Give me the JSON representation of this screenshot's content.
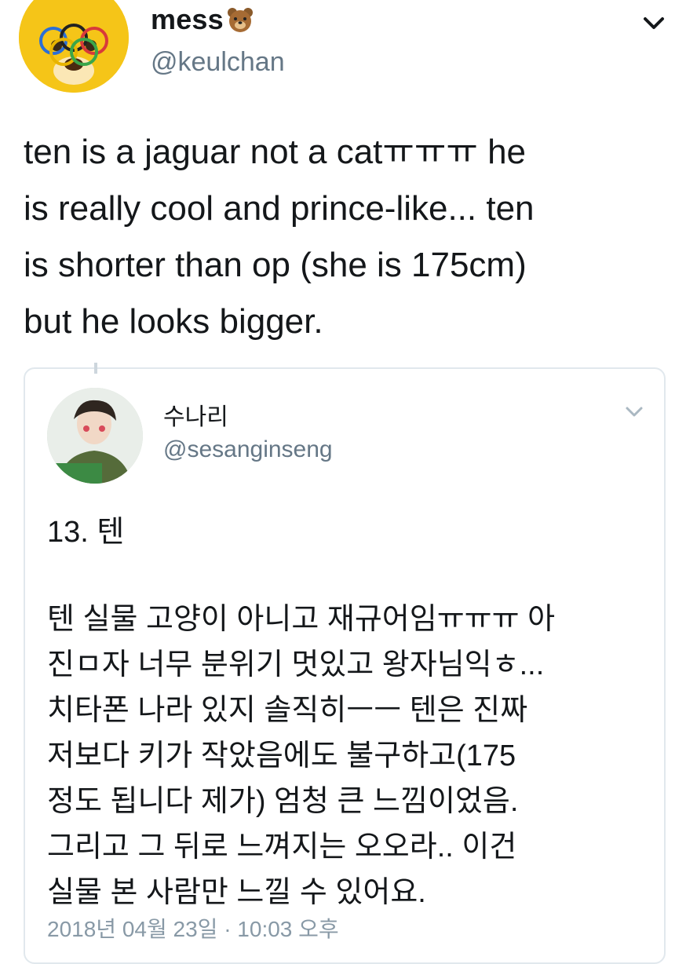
{
  "author": {
    "display_name": "mess",
    "name_emoji": "bear-face-emoji",
    "handle": "@keulchan"
  },
  "tweet": {
    "lines": [
      "ten is a jaguar not a catㅠㅠㅠ he",
      "is really cool and prince-like... ten",
      "is shorter than op (she is 175cm)",
      "but he looks bigger."
    ]
  },
  "quoted": {
    "display_name": "수나리",
    "handle": "@sesanginseng",
    "heading": "13. 텐",
    "lines": [
      "텐 실물 고양이 아니고 재규어임ㅠㅠㅠ 아",
      "진ㅁ자 너무 분위기 멋있고 왕자님익ㅎ...",
      "치타폰 나라 있지 솔직히ㅡㅡ 텐은 진짜",
      "저보다 키가 작았음에도 불구하고(175",
      "정도 됩니다 제가) 엄청 큰 느낌이었음.",
      "그리고 그 뒤로 느껴지는 오오라.. 이건",
      "실물 본 사람만 느낄 수 있어요."
    ],
    "timestamp": "2018년 04월 23일 · 10:03 오후"
  },
  "colors": {
    "text": "#14171a",
    "secondary": "#657786",
    "border": "#e1e8ed",
    "avatar_bg": "#f5c518"
  },
  "icons": {
    "main_avatar": "bear-avatar-icon",
    "chevron": "chevron-down-icon"
  }
}
